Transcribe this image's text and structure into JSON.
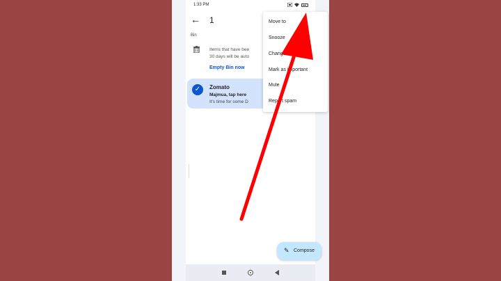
{
  "status_bar": {
    "time": "1:33 PM"
  },
  "toolbar": {
    "back_icon": "arrow-left",
    "selected_count": "1"
  },
  "bin": {
    "section_label": "Bin",
    "notice_line1": "Items that have bee",
    "notice_line2": "30 days will be auto",
    "empty_bin_label": "Empty Bin now"
  },
  "email": {
    "sender": "Zomato",
    "subject": "Majmua, tap here",
    "snippet": "It's time for some D"
  },
  "menu": {
    "items": [
      {
        "label": "Move to"
      },
      {
        "label": "Snooze"
      },
      {
        "label": "Change labels"
      },
      {
        "label": "Mark as important"
      },
      {
        "label": "Mute"
      },
      {
        "label": "Report spam"
      }
    ]
  },
  "compose": {
    "label": "Compose"
  },
  "colors": {
    "background": "#9a4444",
    "accent": "#0b57d0",
    "selected_row": "#d3e3fd",
    "fab": "#c2e7ff",
    "annotation_arrow": "#ff0000"
  }
}
